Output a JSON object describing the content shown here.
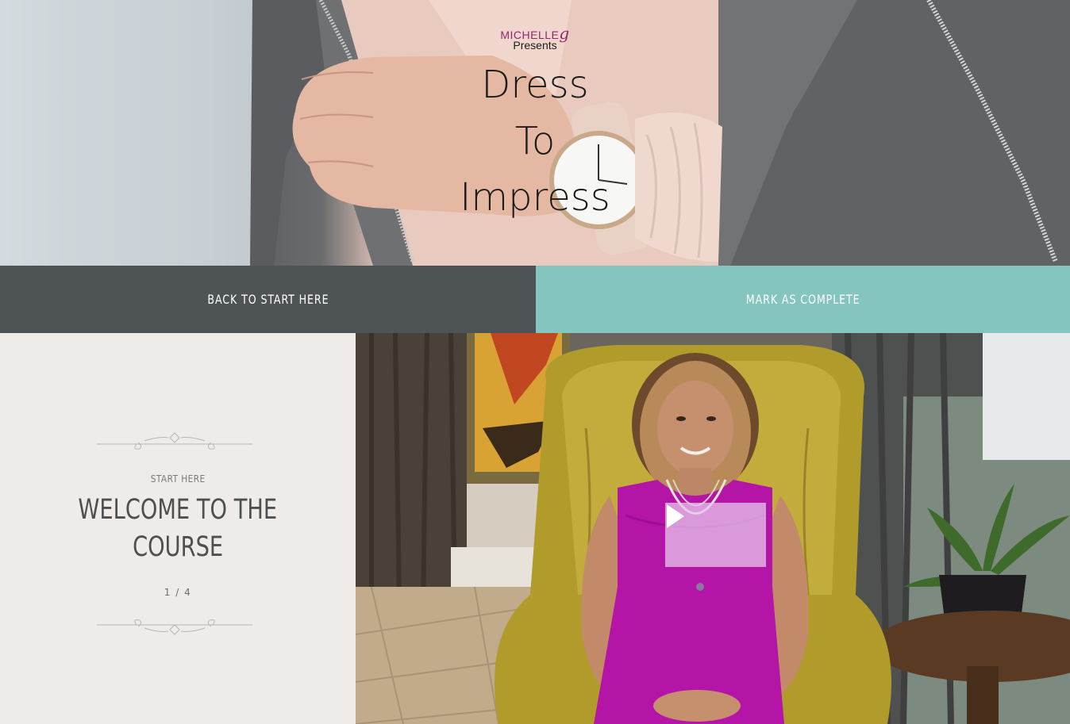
{
  "hero": {
    "brand_name": "MICHELLE",
    "brand_mark": "g",
    "brand_sub": "Presents",
    "title_lines": [
      "Dress",
      "To",
      "Impress"
    ]
  },
  "actions": {
    "back_label": "BACK TO START HERE",
    "complete_label": "MARK AS COMPLETE"
  },
  "lesson": {
    "section": "START HERE",
    "title_line1": "WELCOME TO THE",
    "title_line2": "COURSE",
    "count": "1 / 4"
  },
  "video": {
    "play_icon": "play-icon"
  },
  "colors": {
    "back_button": "#4e5356",
    "complete_button": "#84c5c0",
    "panel_bg": "#eeebe8",
    "brand": "#8d2a6e"
  }
}
